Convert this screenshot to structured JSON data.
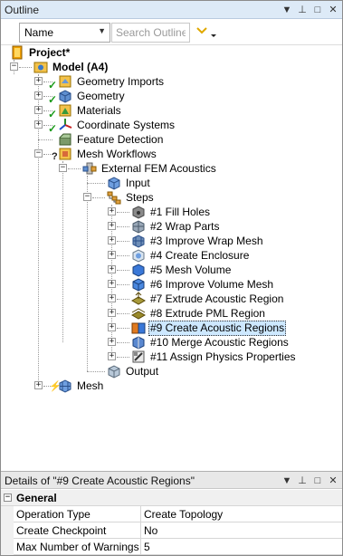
{
  "outline": {
    "title": "Outline",
    "header_buttons": [
      {
        "icon": "dropdown-arrow-icon",
        "glyph": "▼"
      },
      {
        "icon": "pin-icon",
        "glyph": "⊥"
      },
      {
        "icon": "maximize-icon",
        "glyph": "□"
      },
      {
        "icon": "close-icon",
        "glyph": "✕"
      }
    ],
    "name_dropdown": "Name",
    "search_placeholder": "Search Outline"
  },
  "tree": [
    {
      "label": "Project*",
      "bold": true,
      "icon": "project-icon"
    },
    {
      "label": "Model (A4)",
      "bold": true,
      "icon": "model-icon"
    },
    {
      "label": "Geometry Imports",
      "icon": "geometry-imports-icon",
      "status": "check"
    },
    {
      "label": "Geometry",
      "icon": "geometry-icon",
      "status": "check"
    },
    {
      "label": "Materials",
      "icon": "materials-icon",
      "status": "check"
    },
    {
      "label": "Coordinate Systems",
      "icon": "coordinate-systems-icon",
      "status": "check"
    },
    {
      "label": "Feature Detection",
      "icon": "feature-detection-icon"
    },
    {
      "label": "Mesh Workflows",
      "icon": "mesh-workflows-icon",
      "status": "question"
    },
    {
      "label": "External FEM Acoustics",
      "icon": "fem-acoustics-icon"
    },
    {
      "label": "Input",
      "icon": "input-icon"
    },
    {
      "label": "Steps",
      "icon": "steps-icon"
    },
    {
      "label": "#1 Fill Holes",
      "icon": "fill-holes-icon"
    },
    {
      "label": "#2 Wrap Parts",
      "icon": "wrap-parts-icon"
    },
    {
      "label": "#3 Improve Wrap Mesh",
      "icon": "improve-wrap-mesh-icon"
    },
    {
      "label": "#4 Create Enclosure",
      "icon": "create-enclosure-icon"
    },
    {
      "label": "#5 Mesh Volume",
      "icon": "mesh-volume-icon"
    },
    {
      "label": "#6 Improve Volume Mesh",
      "icon": "improve-volume-mesh-icon"
    },
    {
      "label": "#7 Extrude Acoustic Region",
      "icon": "extrude-acoustic-region-icon"
    },
    {
      "label": "#8 Extrude PML Region",
      "icon": "extrude-pml-region-icon"
    },
    {
      "label": "#9 Create Acoustic Regions",
      "icon": "create-acoustic-regions-icon",
      "selected": true
    },
    {
      "label": "#10 Merge Acoustic Regions",
      "icon": "merge-acoustic-regions-icon"
    },
    {
      "label": "#11 Assign Physics Properties",
      "icon": "assign-physics-icon"
    },
    {
      "label": "Output",
      "icon": "output-icon"
    },
    {
      "label": "Mesh",
      "icon": "mesh-icon",
      "status": "bolt"
    }
  ],
  "details": {
    "title": "Details of \"#9 Create Acoustic Regions\"",
    "header_buttons": [
      {
        "icon": "dropdown-arrow-icon",
        "glyph": "▼"
      },
      {
        "icon": "pin-icon",
        "glyph": "⊥"
      },
      {
        "icon": "maximize-icon",
        "glyph": "□"
      },
      {
        "icon": "close-icon",
        "glyph": "✕"
      }
    ],
    "section": "General",
    "rows": [
      {
        "key": "Operation Type",
        "value": "Create Topology"
      },
      {
        "key": "Create Checkpoint",
        "value": "No"
      },
      {
        "key": "Max Number of Warnings",
        "value": "5"
      }
    ]
  },
  "colors": {
    "header_bg": "#ddeaf7",
    "selection_bg": "#cde8ff",
    "check_green": "#1a9a1a"
  }
}
